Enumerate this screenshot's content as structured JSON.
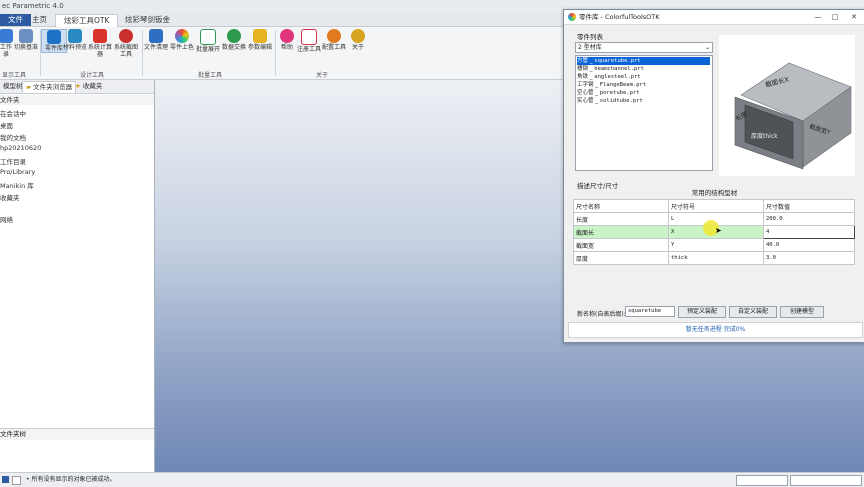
{
  "window": {
    "title": "ec Parametric 4.0"
  },
  "tabs": [
    {
      "label": "文件"
    },
    {
      "label": "主页"
    },
    {
      "label": "炫彩工具OTK"
    },
    {
      "label": "炫彩琴剑钣金"
    }
  ],
  "ribbon": {
    "buttons": [
      {
        "label": "工作\n录",
        "icon": "folder-icon",
        "color": "#3a7bd5"
      },
      {
        "label": "切换基准",
        "icon": "switch-icon",
        "color": "#6a8fc0"
      },
      {
        "label": "零件库",
        "icon": "parts-library-icon",
        "color": "#1f73c7"
      },
      {
        "label": "材料预览",
        "icon": "material-icon",
        "color": "#2b8ac2"
      },
      {
        "label": "系统计算\n器",
        "icon": "calculator-icon",
        "color": "#d9342b"
      },
      {
        "label": "系统截图\n工具",
        "icon": "screenshot-icon",
        "color": "#c9302c"
      },
      {
        "label": "文件清理",
        "icon": "broom-icon",
        "color": "#2f6fc0"
      },
      {
        "label": "零件上色",
        "icon": "color-wheel-icon",
        "color": "#e0a030"
      },
      {
        "label": "批量展开",
        "icon": "expand-icon",
        "color": "#2e9a55"
      },
      {
        "label": "数据交换",
        "icon": "exchange-icon",
        "color": "#2c9a4a"
      },
      {
        "label": "参数编辑",
        "icon": "pencil-icon",
        "color": "#e6b422"
      },
      {
        "label": "帮助",
        "icon": "help-icon",
        "color": "#e0357a"
      },
      {
        "label": "注册工具",
        "icon": "heart-icon",
        "color": "#d4324a"
      },
      {
        "label": "配置工具",
        "icon": "config-icon",
        "color": "#e07a20"
      },
      {
        "label": "关于",
        "icon": "about-icon",
        "color": "#d9a520"
      }
    ],
    "groups": [
      "显示工具",
      "设计工具",
      "批量工具",
      "关于"
    ]
  },
  "left_panel": {
    "tabs": [
      "模型树",
      "文件夹浏览器",
      "收藏夹"
    ],
    "header": "文件夹",
    "items": [
      "在会话中",
      "桌面",
      "我的文档",
      "hp20210620",
      "工作目录",
      "Pro/Library",
      "Manikin 库",
      "收藏夹",
      "网络"
    ],
    "footer": "文件夹树"
  },
  "status_bar": {
    "message": "• 所有没有显示的对象已被成功。"
  },
  "dialog": {
    "title": "零件库 - ColorfulToolsOTK",
    "part_list_label": "零件列表",
    "library_selected": "2 型材库",
    "parts": [
      {
        "name": "方管",
        "file": "squaretube.prt",
        "selected": true
      },
      {
        "name": "槽钢",
        "file": "beamchannel.prt",
        "selected": false
      },
      {
        "name": "角铁",
        "file": "anglesteel.prt",
        "selected": false
      },
      {
        "name": "工字钢",
        "file": "FlangeBeam.prt",
        "selected": false
      },
      {
        "name": "空心管",
        "file": "poretube.prt",
        "selected": false
      },
      {
        "name": "实心管",
        "file": "solidtube.prt",
        "selected": false
      }
    ],
    "preview_labels": {
      "a": "截面长X",
      "b": "长度",
      "c": "厚度thick",
      "d": "截面宽Y"
    },
    "description_label": "描述尺寸/尺寸",
    "table_title": "常用的结构型材",
    "columns": [
      "尺寸名称",
      "尺寸符号",
      "尺寸数值"
    ],
    "rows": [
      {
        "name": "长度",
        "symbol": "L",
        "value": "200.0"
      },
      {
        "name": "截面长",
        "symbol": "X",
        "value": "4"
      },
      {
        "name": "截面宽",
        "symbol": "Y",
        "value": "40.0"
      },
      {
        "name": "厚度",
        "symbol": "thick",
        "value": "3.0"
      }
    ],
    "new_name_label": "新名称(自表后缀):",
    "new_name_value": "squaretube",
    "buttons": [
      "预定义装配",
      "自定义装配",
      "创建模型"
    ],
    "status": "暂无任务进程  完成0%"
  }
}
